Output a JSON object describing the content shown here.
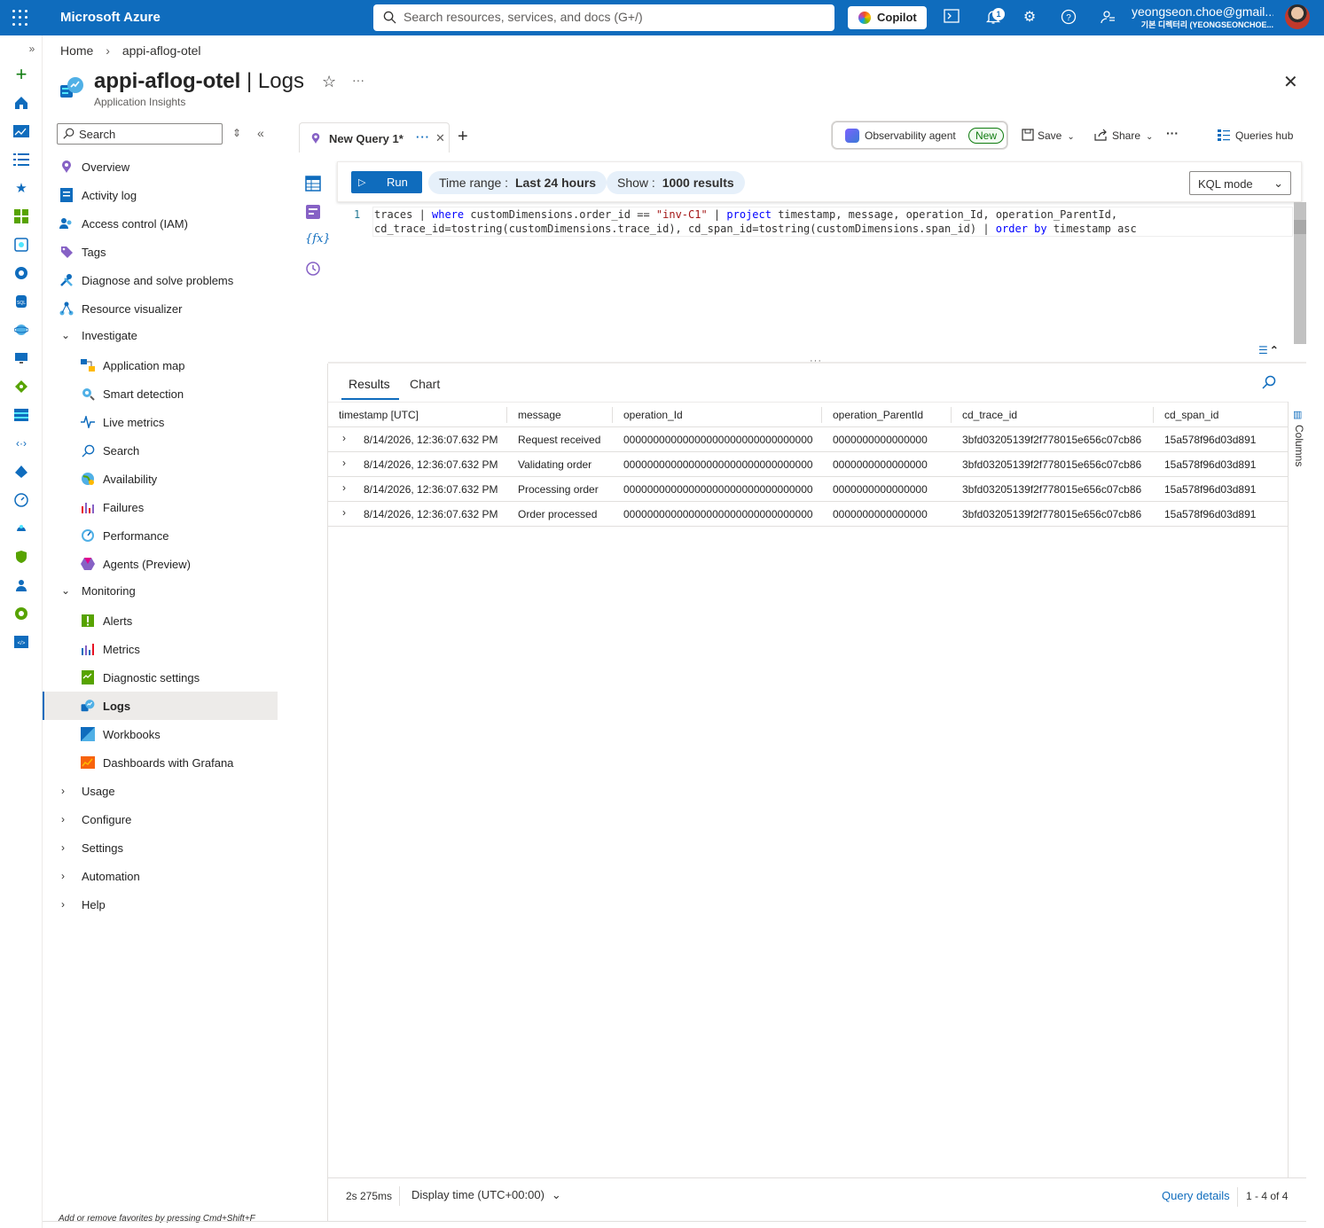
{
  "topbar": {
    "brand": "Microsoft Azure",
    "search_placeholder": "Search resources, services, and docs (G+/)",
    "copilot_label": "Copilot",
    "notification_count": "1",
    "user_email": "yeongseon.choe@gmail...",
    "user_directory": "기본 디렉터리 (YEONGSEONCHOE..."
  },
  "breadcrumb": {
    "home": "Home",
    "sep": "›",
    "current": "appi-aflog-otel"
  },
  "page": {
    "resource": "appi-aflog-otel",
    "divider": " | ",
    "section": "Logs",
    "subtitle": "Application Insights",
    "star": "☆",
    "more": "···"
  },
  "nav": {
    "search_placeholder": "Search",
    "items": [
      {
        "label": "Overview",
        "icon": "overview-icon"
      },
      {
        "label": "Activity log",
        "icon": "activity-log-icon"
      },
      {
        "label": "Access control (IAM)",
        "icon": "iam-icon"
      },
      {
        "label": "Tags",
        "icon": "tag-icon"
      },
      {
        "label": "Diagnose and solve problems",
        "icon": "wrench-icon"
      },
      {
        "label": "Resource visualizer",
        "icon": "visualizer-icon"
      }
    ],
    "investigate": {
      "label": "Investigate",
      "items": [
        "Application map",
        "Smart detection",
        "Live metrics",
        "Search",
        "Availability",
        "Failures",
        "Performance",
        "Agents (Preview)"
      ]
    },
    "monitoring": {
      "label": "Monitoring",
      "items": [
        "Alerts",
        "Metrics",
        "Diagnostic settings",
        "Logs",
        "Workbooks",
        "Dashboards with Grafana"
      ]
    },
    "collapsed": [
      "Usage",
      "Configure",
      "Settings",
      "Automation",
      "Help"
    ],
    "hint": "Add or remove favorites by pressing Cmd+Shift+F"
  },
  "query_tab": {
    "label": "New Query 1*",
    "more": "···"
  },
  "toolbar": {
    "observability": "Observability agent",
    "new_badge": "New",
    "save": "Save",
    "share": "Share",
    "more": "···",
    "queries_hub": "Queries hub"
  },
  "querybar": {
    "run": "Run",
    "time_range_label": "Time range :",
    "time_range_value": "Last 24 hours",
    "show_label": "Show :",
    "show_value": "1000 results",
    "mode": "KQL mode"
  },
  "editor": {
    "line_number": "1",
    "query": "traces | where customDimensions.order_id == \"inv-C1\" | project timestamp, message, operation_Id, operation_ParentId, cd_trace_id=tostring(customDimensions.trace_id), cd_span_id=tostring(customDimensions.span_id) | order by timestamp asc"
  },
  "results": {
    "tabs": [
      "Results",
      "Chart"
    ],
    "columns": [
      "timestamp [UTC]",
      "message",
      "operation_Id",
      "operation_ParentId",
      "cd_trace_id",
      "cd_span_id"
    ],
    "rows": [
      [
        "8/14/2026, 12:36:07.632 PM",
        "Request received",
        "00000000000000000000000000000000",
        "0000000000000000",
        "3bfd03205139f2f778015e656c07cb86",
        "15a578f96d03d891"
      ],
      [
        "8/14/2026, 12:36:07.632 PM",
        "Validating order",
        "00000000000000000000000000000000",
        "0000000000000000",
        "3bfd03205139f2f778015e656c07cb86",
        "15a578f96d03d891"
      ],
      [
        "8/14/2026, 12:36:07.632 PM",
        "Processing order",
        "00000000000000000000000000000000",
        "0000000000000000",
        "3bfd03205139f2f778015e656c07cb86",
        "15a578f96d03d891"
      ],
      [
        "8/14/2026, 12:36:07.632 PM",
        "Order processed",
        "00000000000000000000000000000000",
        "0000000000000000",
        "3bfd03205139f2f778015e656c07cb86",
        "15a578f96d03d891"
      ]
    ],
    "columns_panel": "Columns"
  },
  "footer": {
    "duration": "2s 275ms",
    "display_time": "Display time (UTC+00:00)",
    "query_details": "Query details",
    "count": "1 - 4 of 4"
  },
  "colors": {
    "accent": "#0f6cbd",
    "new_badge": "#107c10"
  }
}
